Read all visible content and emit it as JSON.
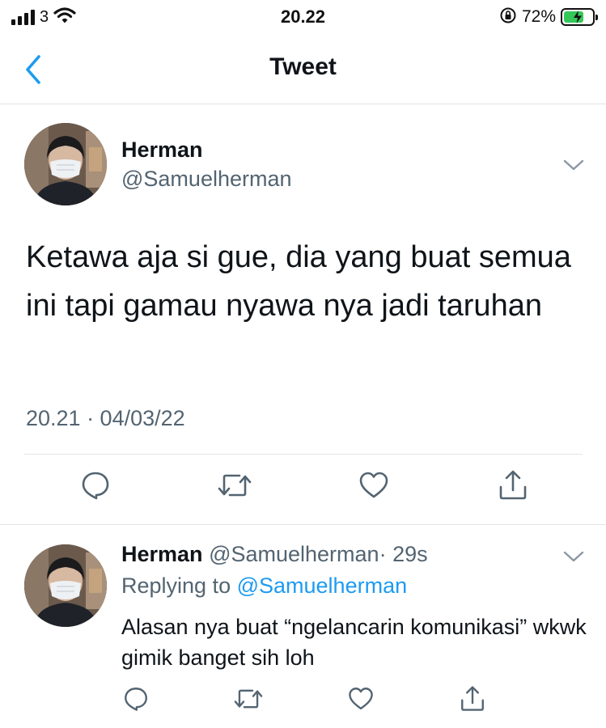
{
  "status_bar": {
    "carrier": "3",
    "time": "20.22",
    "battery_percent": "72%",
    "battery_level": 0.72,
    "signal_bars": 4,
    "icons": [
      "signal-icon",
      "wifi-icon",
      "rotation-lock-icon",
      "battery-charging-icon"
    ]
  },
  "nav": {
    "title": "Tweet",
    "back_icon": "chevron-left-icon"
  },
  "main_tweet": {
    "author_name": "Herman",
    "author_handle": "@Samuelherman",
    "text": "Ketawa aja si gue, dia yang buat semua ini tapi gamau nyawa nya jadi taruhan",
    "meta": "20.21 · 04/03/22",
    "actions": [
      "reply-icon",
      "retweet-icon",
      "like-icon",
      "share-icon"
    ]
  },
  "reply": {
    "author_name": "Herman",
    "author_handle": "@Samuelherman",
    "time_ago": "· 29s",
    "replying_prefix": "Replying to ",
    "replying_to": "@Samuelherman",
    "text": "Alasan nya buat “ngelancarin komunikasi” wkwk gimik banget sih loh",
    "actions": [
      "reply-icon",
      "retweet-icon",
      "like-icon",
      "share-icon"
    ]
  },
  "colors": {
    "accent": "#1d9bf0",
    "secondary_text": "#536471",
    "primary_text": "#0f1419",
    "divider": "#e1e4e8",
    "battery_fill": "#34c759"
  }
}
